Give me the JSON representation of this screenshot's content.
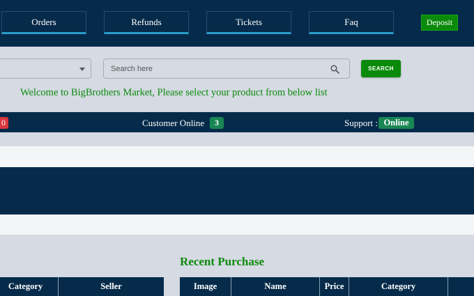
{
  "nav": {
    "items": [
      {
        "label": "Orders"
      },
      {
        "label": "Refunds"
      },
      {
        "label": "Tickets"
      },
      {
        "label": "Faq"
      }
    ],
    "deposit_label": "Deposit"
  },
  "search": {
    "placeholder": "Search here",
    "value": "",
    "button_label": "SEARCH"
  },
  "welcome_text": "Welcome to BigBrothers Market, Please select your product from below list",
  "status": {
    "left_badge": "0",
    "customer_label": "Customer Online",
    "customer_count": "3",
    "support_label": "Support :",
    "support_status": "Online"
  },
  "recent": {
    "title": "Recent Purchase",
    "left_table_headers": [
      "Category",
      "Seller"
    ],
    "right_table_headers": [
      "Image",
      "Name",
      "Price",
      "Category"
    ]
  },
  "colors": {
    "navy": "#062b4a",
    "green": "#0a8a0a",
    "badge_green": "#198754",
    "badge_red": "#d9363e",
    "accent_blue": "#2a9bc9"
  }
}
